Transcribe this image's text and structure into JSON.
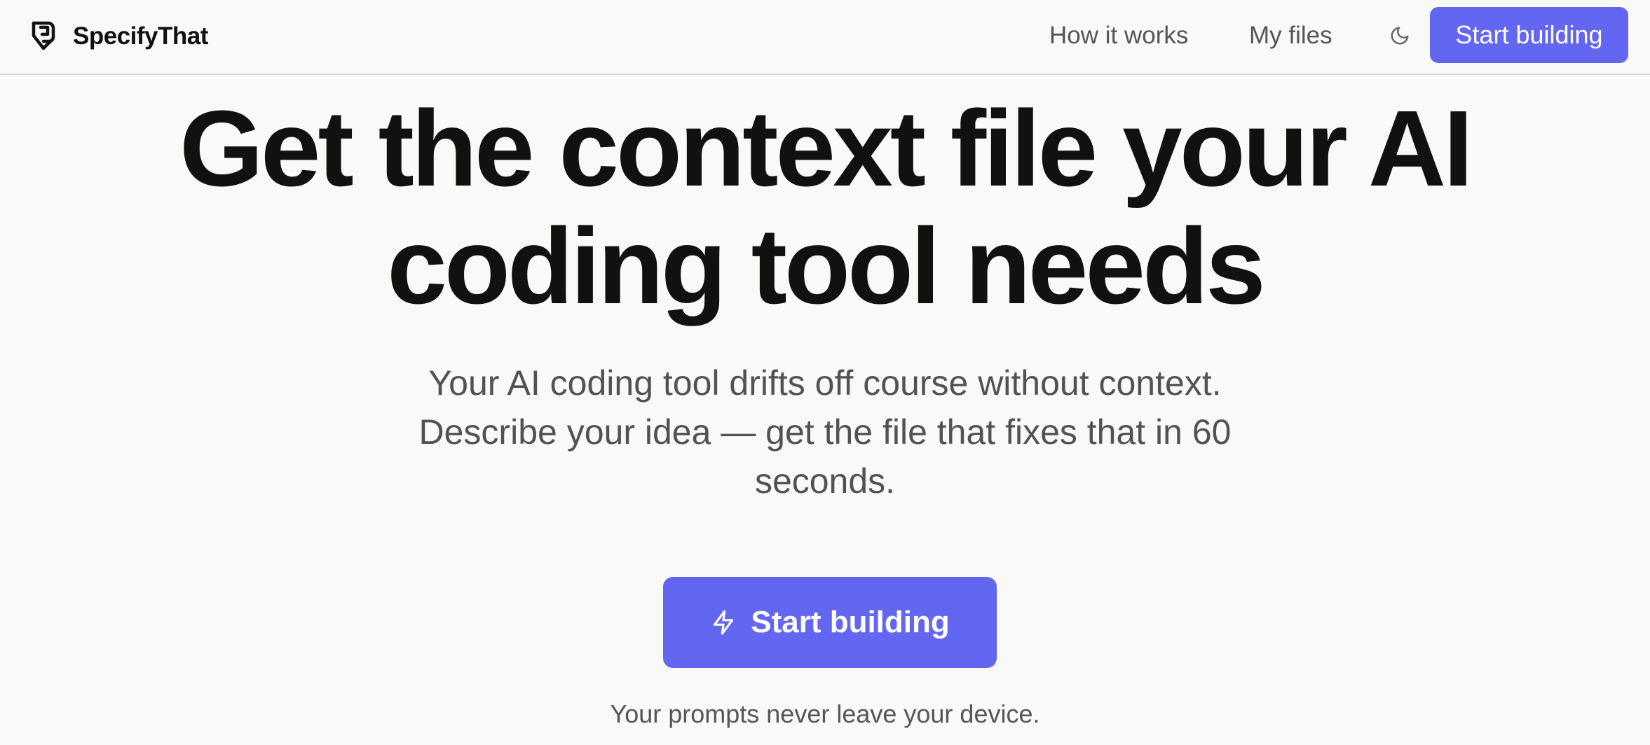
{
  "nav": {
    "brand": "SpecifyThat",
    "links": [
      "How it works",
      "My files"
    ],
    "theme_icon": "moon-icon",
    "cta_label": "Start building"
  },
  "hero": {
    "title_lines": [
      "Get the context file your AI",
      "coding tool needs"
    ],
    "subtitle_lines": [
      "Your AI coding tool drifts off course without context.",
      "Describe your idea — get the file that fixes that in 60",
      "seconds."
    ],
    "cta_label": "Start building",
    "cta_icon": "lightning-bolt-icon",
    "privacy_note": "Your prompts never leave your device."
  },
  "colors": {
    "accent": "#6366f1",
    "background": "#f9f9f7",
    "heading": "#111111",
    "muted_text": "#555555"
  }
}
